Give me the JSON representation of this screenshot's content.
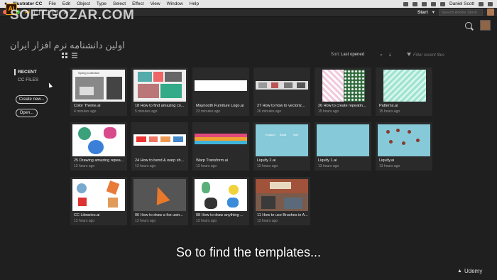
{
  "menubar": {
    "apple": "",
    "app_name": "Illustrator CC",
    "items": [
      "File",
      "Edit",
      "Object",
      "Type",
      "Select",
      "Effect",
      "View",
      "Window",
      "Help"
    ],
    "user": "Daniel Scott"
  },
  "toolbar": {
    "ai_label": "Ai",
    "workspace": "Start",
    "search_placeholder": "Search Adobe Stock"
  },
  "watermark": {
    "latin": "SOFTGOZAR.COM",
    "farsi": "اولین دانشنامه نرم افزار ایران"
  },
  "app_logo": "Ai",
  "sort": {
    "label": "Sort:",
    "value": "Last opened"
  },
  "filter": {
    "placeholder": "Filter recent files"
  },
  "sidebar": {
    "recent": "RECENT",
    "cc_files": "CC FILES",
    "create_new": "Create new...",
    "open": "Open..."
  },
  "files": [
    {
      "name": "Color Theme.ai",
      "time": "4 minutes ago"
    },
    {
      "name": "18 How to find amazing co...",
      "time": "5 minutes ago"
    },
    {
      "name": "Maynooth Furniture Logo.ai",
      "time": "23 minutes ago"
    },
    {
      "name": "27 How to how to vectoriz...",
      "time": "26 minutes ago"
    },
    {
      "name": "26 How to create repeatin...",
      "time": "15 hours ago"
    },
    {
      "name": "Patterns.ai",
      "time": "15 hours ago"
    },
    {
      "name": "25 Drawing amazing repea...",
      "time": "13 hours ago"
    },
    {
      "name": "24 How to bend & warp sh...",
      "time": "13 hours ago"
    },
    {
      "name": "Warp Transform.ai",
      "time": "13 hours ago"
    },
    {
      "name": "Liquify 2.ai",
      "time": "13 hours ago"
    },
    {
      "name": "Liquify 1.ai",
      "time": "13 hours ago"
    },
    {
      "name": "Liquify.ai",
      "time": "13 hours ago"
    },
    {
      "name": "CC Libraries.ai",
      "time": "13 hours ago"
    },
    {
      "name": "06 How to draw a fox usin...",
      "time": "13 hours ago"
    },
    {
      "name": "08 How to draw anything ...",
      "time": "13 hours ago"
    },
    {
      "name": "11 How to use Brushes in A...",
      "time": "13 hours ago"
    }
  ],
  "thumb_text": {
    "spring": "Spring Collection",
    "liquify2_words": [
      "Expand",
      "Bloat",
      "Twirl"
    ]
  },
  "subtitle": "So to find the templates...",
  "udemy": "Udemy"
}
